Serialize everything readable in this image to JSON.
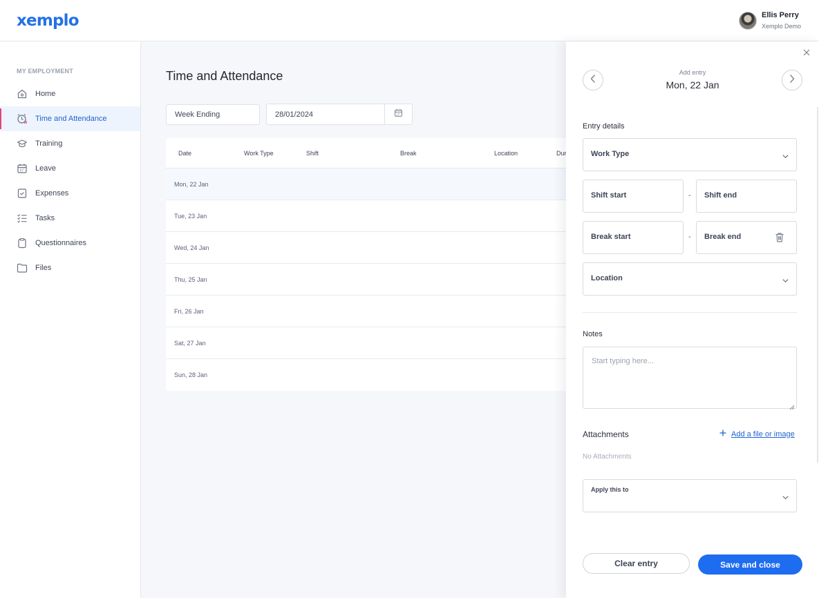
{
  "header": {
    "logo": "xemplo",
    "user_name": "Ellis Perry",
    "user_company": "Xemplo Demo"
  },
  "sidebar": {
    "heading": "MY EMPLOYMENT",
    "items": [
      {
        "label": "Home",
        "icon": "home-icon"
      },
      {
        "label": "Time and Attendance",
        "icon": "clock-icon",
        "active": true
      },
      {
        "label": "Training",
        "icon": "graduation-cap-icon"
      },
      {
        "label": "Leave",
        "icon": "calendar-icon"
      },
      {
        "label": "Expenses",
        "icon": "receipt-check-icon"
      },
      {
        "label": "Tasks",
        "icon": "checklist-icon"
      },
      {
        "label": "Questionnaires",
        "icon": "clipboard-icon"
      },
      {
        "label": "Files",
        "icon": "folder-icon"
      }
    ]
  },
  "main": {
    "title": "Time and Attendance",
    "week_filter": "Week Ending",
    "date_value": "28/01/2024",
    "table": {
      "columns": [
        "Date",
        "Work Type",
        "Shift",
        "Break",
        "Location",
        "Dur"
      ],
      "rows": [
        "Mon, 22 Jan",
        "Tue, 23 Jan",
        "Wed, 24 Jan",
        "Thu, 25 Jan",
        "Fri, 26 Jan",
        "Sat, 27 Jan",
        "Sun, 28 Jan"
      ]
    }
  },
  "drawer": {
    "subtitle": "Add entry",
    "date": "Mon, 22 Jan",
    "entry_details_label": "Entry details",
    "work_type_label": "Work Type",
    "shift_start_label": "Shift start",
    "shift_end_label": "Shift end",
    "break_start_label": "Break start",
    "break_end_label": "Break end",
    "separator": "-",
    "location_label": "Location",
    "notes_label": "Notes",
    "notes_placeholder": "Start typing here...",
    "attachments_label": "Attachments",
    "add_file_label": "Add a file or image",
    "no_attachments": "No Attachments",
    "apply_label": "Apply this to",
    "clear_label": "Clear entry",
    "save_label": "Save and close"
  },
  "colors": {
    "accent": "#1e6cf0",
    "active_nav_bg": "#eef4fd",
    "active_marker": "#e0467c"
  }
}
